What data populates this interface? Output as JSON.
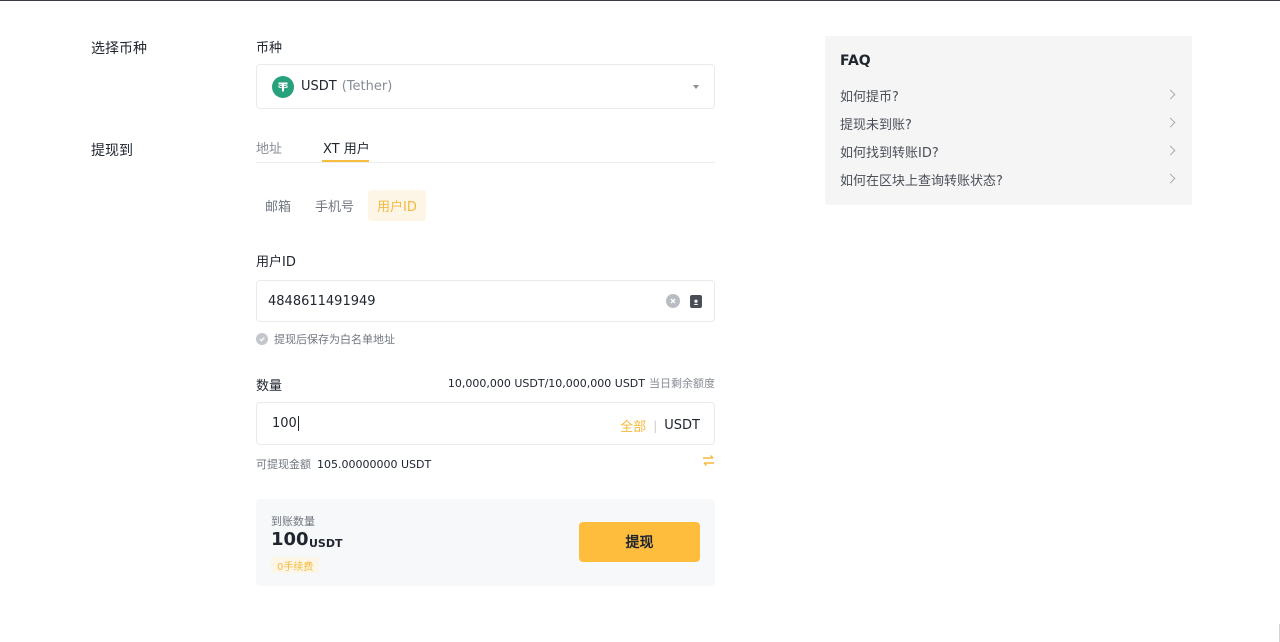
{
  "labels": {
    "select_coin": "选择币种",
    "withdraw_to": "提现到"
  },
  "coin": {
    "field_label": "币种",
    "symbol": "USDT",
    "name": "(Tether)",
    "icon": "tether-icon",
    "brand_color": "#26a17b"
  },
  "destination_tabs": [
    {
      "label": "地址",
      "active": false
    },
    {
      "label": "XT 用户",
      "active": true
    }
  ],
  "user_type_tabs": [
    {
      "label": "邮箱",
      "active": false
    },
    {
      "label": "手机号",
      "active": false
    },
    {
      "label": "用户ID",
      "active": true
    }
  ],
  "user_id": {
    "field_label": "用户ID",
    "value": "4848611491949",
    "whitelist_text": "提现后保存为白名单地址"
  },
  "amount": {
    "field_label": "数量",
    "quota_value": "10,000,000 USDT/10,000,000 USDT",
    "quota_note": "当日剩余额度",
    "value": "100",
    "all_label": "全部",
    "separator": "|",
    "unit": "USDT",
    "available_label": "可提现金额",
    "available_value": "105.00000000 USDT"
  },
  "summary": {
    "label": "到账数量",
    "amount": "100",
    "unit": "USDT",
    "fee_badge": "0手续费",
    "withdraw_button": "提现"
  },
  "faq": {
    "title": "FAQ",
    "items": [
      "如何提币?",
      "提现未到账?",
      "如何找到转账ID?",
      "如何在区块上查询转账状态?"
    ]
  },
  "colors": {
    "accent": "#f7bd3c",
    "button": "#ffbd3e",
    "text": "#202630",
    "muted": "#868c94"
  }
}
